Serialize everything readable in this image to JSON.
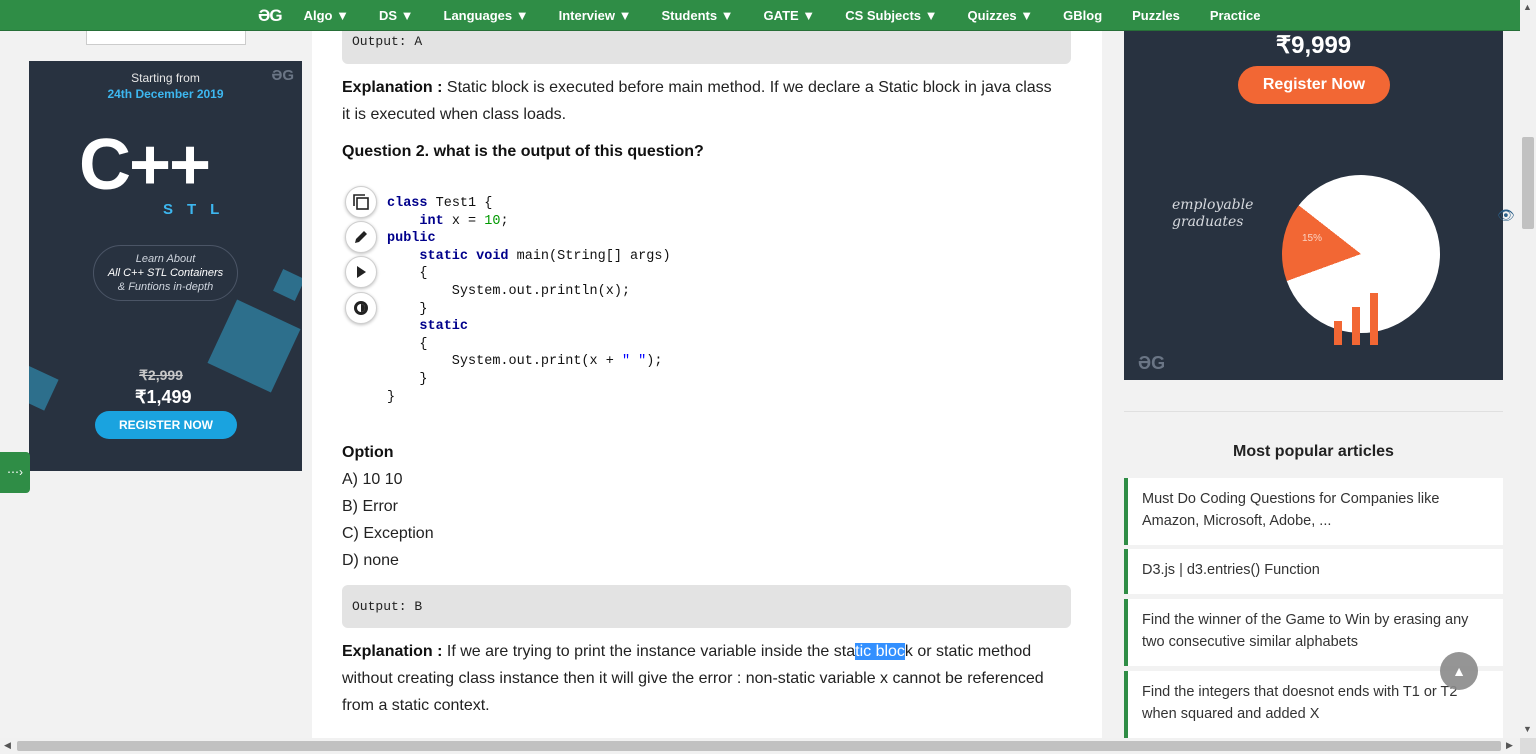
{
  "nav": {
    "logo": "ƏG",
    "items": [
      "Algo ▼",
      "DS ▼",
      "Languages ▼",
      "Interview ▼",
      "Students ▼",
      "GATE ▼",
      "CS Subjects ▼",
      "Quizzes ▼",
      "GBlog",
      "Puzzles",
      "Practice"
    ]
  },
  "ad_left": {
    "starting": "Starting from",
    "date": "24th December 2019",
    "logo": "ƏG",
    "title": "C++",
    "subtitle": "STL",
    "learn_1": "Learn About",
    "learn_2": "All C++ STL Containers",
    "learn_3": "& Funtions in-depth",
    "old_price": "₹2,999",
    "new_price": "₹1,499",
    "cta": "REGISTER NOW"
  },
  "side_tab_icon": "arrow-right-icon",
  "content": {
    "output_a": "Output: A",
    "expl1_label": "Explanation :",
    "expl1_text": " Static block is executed before main method. If we declare a Static block in java class it is executed when class loads.",
    "question2": "Question 2. what is the output of this question?",
    "option_heading": "Option",
    "options": [
      "A) 10 10",
      "B) Error",
      "C) Exception",
      "D) none"
    ],
    "output_b": "Output: B",
    "expl2_label": "Explanation :",
    "expl2_pre": " If we are trying to print the instance variable inside the sta",
    "expl2_sel": "tic bloc",
    "expl2_post": "k or static method without creating class instance then it will give the error : non-static variable x cannot be referenced from a static context."
  },
  "code_tools": [
    "copy-icon",
    "edit-icon",
    "run-icon",
    "theme-icon"
  ],
  "ad_right": {
    "price": "₹9,999",
    "cta": "Register Now",
    "label": "employable graduates",
    "percent": "15%",
    "logo": "ƏG"
  },
  "popular": {
    "title": "Most popular articles",
    "articles": [
      "Must Do Coding Questions for Companies like Amazon, Microsoft, Adobe, ...",
      "D3.js | d3.entries() Function",
      "Find the winner of the Game to Win by erasing any two consecutive similar alphabets",
      "Find the integers that doesnot ends with T1 or T2 when squared and added X"
    ]
  },
  "colors": {
    "brand_green": "#2f8d46",
    "ad_bg": "#283240",
    "accent_blue": "#1aa3df",
    "accent_orange": "#f26734"
  }
}
